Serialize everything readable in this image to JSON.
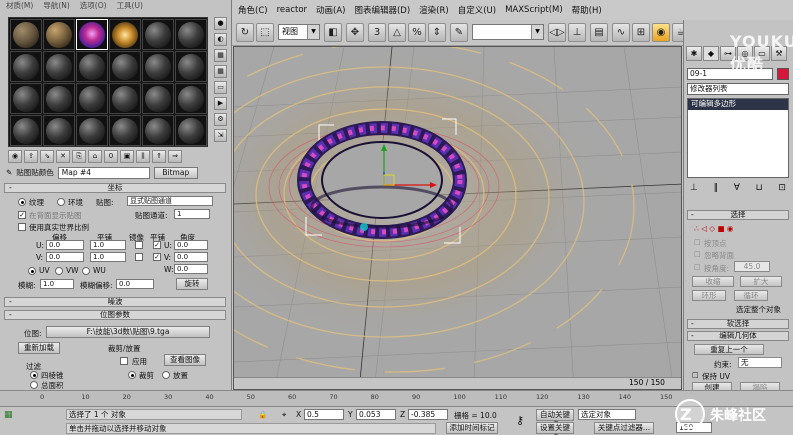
{
  "menu": {
    "items": [
      "角色(C)",
      "reactor",
      "动画(A)",
      "图表编辑器(D)",
      "渲染(R)",
      "自定义(U)",
      "MAXScript(M)",
      "帮助(H)"
    ]
  },
  "toolbar": {
    "view_combo": "视图",
    "selection_set_combo": "",
    "right_view_combo": "视图"
  },
  "material_editor": {
    "menu": [
      "材质(M)",
      "导航(N)",
      "选项(O)",
      "工具(U)"
    ],
    "slot_count": 24,
    "selected_slot": 2,
    "picker_label": "贴图贴颜色",
    "map_name": "Map #4",
    "map_type": "Bitmap",
    "coordinates": {
      "title": "坐标",
      "texture_label": "纹理",
      "environ_label": "环境",
      "mapping_label": "贴图:",
      "mapping_value": "显式贴图通道",
      "show_map_on_back": "在背面显示贴图",
      "map_channel_label": "贴图通道:",
      "map_channel_value": "1",
      "use_real_world": "使用真实世界比例",
      "offset_label": "偏移",
      "tiling_label": "平铺",
      "mirror_label": "镜像",
      "tile_label": "平铺",
      "angle_label": "角度",
      "u_label": "U:",
      "v_label": "V:",
      "w_label": "W:",
      "u_offset": "0.0",
      "v_offset": "0.0",
      "u_tiling": "1.0",
      "v_tiling": "1.0",
      "u_angle": "0.0",
      "v_angle": "0.0",
      "w_angle": "0.0",
      "uv": "UV",
      "vw": "VW",
      "wu": "WU",
      "blur_label": "模糊:",
      "blur_value": "1.0",
      "blur_offset_label": "模糊偏移:",
      "blur_offset_value": "0.0",
      "rotate_button": "旋转"
    },
    "noise_title": "噪波",
    "bitmap_params": {
      "title": "位图参数",
      "bitmap_label": "位图:",
      "bitmap_path": "F:\\技能\\3d数\\贴图\\9.tga",
      "reload_button": "重新加载",
      "crop_label": "裁剪/放置",
      "apply_label": "应用",
      "view_image_button": "查看图像",
      "crop_radio": "裁剪",
      "place_radio": "放置",
      "filter_label": "过滤",
      "filter_quad": "四棱锥",
      "filter_sum": "总面积"
    }
  },
  "viewport": {
    "frame_counter": "150 / 150"
  },
  "command_panel": {
    "object_name": "09-1",
    "object_color": "#d4173b",
    "modifier_list": "修改器列表",
    "stack_item": "可编辑多边形",
    "selection": {
      "title": "选择",
      "by_vertex": "按顶点",
      "ignore_backfacing": "忽略背面",
      "by_angle": "按角度:",
      "angle_value": "45.0",
      "shrink": "收缩",
      "grow": "扩大",
      "ring": "环形",
      "loop": "循环",
      "selected_summary": "选定整个对象"
    },
    "soft_selection_title": "软选择",
    "edit_geometry": {
      "title": "编辑几何体",
      "repeat_last": "重复上一个",
      "constraints_label": "约束:",
      "constraints_value": "无",
      "preserve_uv": "保持 UV",
      "create": "创建",
      "collapse": "塌陷"
    }
  },
  "timeline": {
    "ticks": [
      "0",
      "10",
      "20",
      "30",
      "40",
      "50",
      "60",
      "70",
      "80",
      "90",
      "100",
      "110",
      "120",
      "130",
      "140",
      "150"
    ]
  },
  "status": {
    "selected_text": "选择了 1 个 对象",
    "prompt_text": "单击并拖动以选择并移动对象",
    "x_label": "X",
    "x_value": "0.5",
    "y_label": "Y",
    "y_value": "0.053",
    "z_label": "Z",
    "z_value": "-0.385",
    "grid_text": "栅格 = 10.0",
    "add_time_tag": "添加时间标记",
    "auto_key": "自动关键点",
    "selected_object": "选定对象",
    "set_key": "设置关键点",
    "key_filters": "关键点过滤器...",
    "frame_value": "150"
  },
  "watermarks": {
    "youku": "YOUKU 优酷",
    "site": "朱峰社区"
  }
}
